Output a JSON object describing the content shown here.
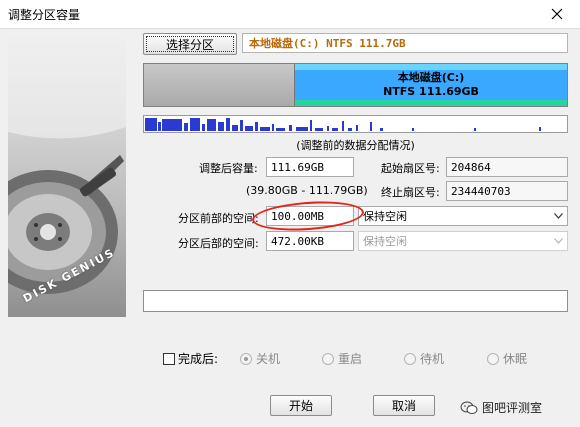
{
  "window": {
    "title": "调整分区容量"
  },
  "side_art": {
    "brand": "DISK GENIUS"
  },
  "top": {
    "select_button": "选择分区",
    "disk_label": "本地磁盘(C:) NTFS 111.7GB"
  },
  "partition_bar": {
    "name": "本地磁盘(C:)",
    "detail": "NTFS 111.69GB"
  },
  "usage_caption": "(调整前的数据分配情况)",
  "form": {
    "size_label": "调整后容量:",
    "size_value": "111.69GB",
    "range_text": "(39.80GB - 111.79GB)",
    "start_sector_label": "起始扇区号:",
    "start_sector_value": "204864",
    "end_sector_label": "终止扇区号:",
    "end_sector_value": "234440703",
    "before_space_label": "分区前部的空间:",
    "before_space_value": "100.00MB",
    "before_space_option": "保持空闲",
    "after_space_label": "分区后部的空间:",
    "after_space_value": "472.00KB",
    "after_space_option": "保持空闲"
  },
  "completion": {
    "checkbox_label": "完成后:",
    "options": [
      "关机",
      "重启",
      "待机",
      "休眠"
    ],
    "selected": "关机"
  },
  "buttons": {
    "start": "开始",
    "cancel": "取消"
  },
  "watermark": "图吧评测室",
  "colors": {
    "partition_fill": "#3aa8ff",
    "usage_fill": "#2a3bd1",
    "annotation_circle": "#e0261a",
    "disk_label_text": "#b8690a"
  }
}
